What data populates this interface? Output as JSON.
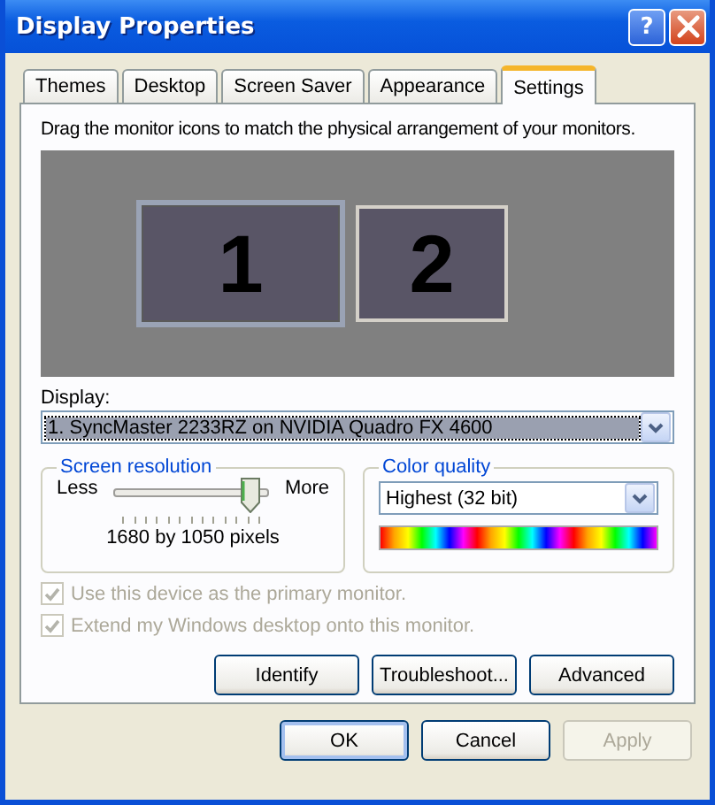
{
  "window": {
    "title": "Display Properties",
    "help_button": "?"
  },
  "tabs": [
    {
      "label": "Themes",
      "selected": false
    },
    {
      "label": "Desktop",
      "selected": false
    },
    {
      "label": "Screen Saver",
      "selected": false
    },
    {
      "label": "Appearance",
      "selected": false
    },
    {
      "label": "Settings",
      "selected": true
    }
  ],
  "instruction": "Drag the monitor icons to match the physical arrangement of your monitors.",
  "monitors": [
    {
      "label": "1",
      "selected": true
    },
    {
      "label": "2",
      "selected": false
    }
  ],
  "display": {
    "label": "Display:",
    "value": "1. SyncMaster 2233RZ on NVIDIA Quadro FX 4600"
  },
  "resolution": {
    "title": "Screen resolution",
    "min_label": "Less",
    "max_label": "More",
    "level": 0.95,
    "reading": "1680 by 1050 pixels"
  },
  "color_quality": {
    "title": "Color quality",
    "value": "Highest (32 bit)"
  },
  "options": [
    {
      "label": "Use this device as the primary monitor.",
      "checked": true,
      "disabled": true
    },
    {
      "label": "Extend my Windows desktop onto this monitor.",
      "checked": true,
      "disabled": true
    }
  ],
  "tab_buttons": [
    {
      "label": "Identify",
      "disabled": false
    },
    {
      "label": "Troubleshoot...",
      "disabled": false
    },
    {
      "label": "Advanced",
      "disabled": false
    }
  ],
  "dialog_buttons": [
    {
      "label": "OK",
      "disabled": false,
      "default": true
    },
    {
      "label": "Cancel",
      "disabled": false,
      "default": false
    },
    {
      "label": "Apply",
      "disabled": true,
      "default": false
    }
  ]
}
